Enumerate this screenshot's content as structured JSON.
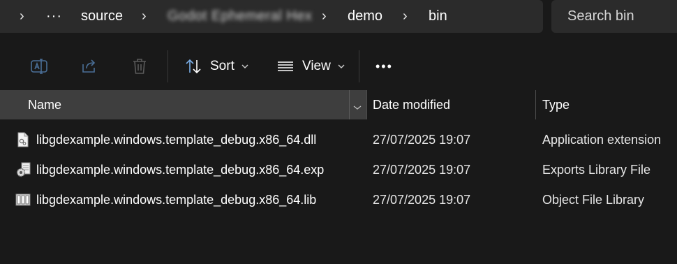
{
  "address": {
    "overflow": "···",
    "crumbs": [
      "source",
      "Godot Ephemeral Hex",
      "demo",
      "bin"
    ]
  },
  "search": {
    "placeholder": "Search bin"
  },
  "toolbar": {
    "rename_icon": "rename-icon",
    "share_icon": "share-icon",
    "delete_icon": "trash-icon",
    "sort_label": "Sort",
    "view_label": "View",
    "more_label": "•••"
  },
  "columns": {
    "name": "Name",
    "date": "Date modified",
    "type": "Type"
  },
  "files": [
    {
      "name": "libgdexample.windows.template_debug.x86_64.dll",
      "date": "27/07/2025 19:07",
      "type": "Application extension",
      "icon": "dll-file-icon"
    },
    {
      "name": "libgdexample.windows.template_debug.x86_64.exp",
      "date": "27/07/2025 19:07",
      "type": "Exports Library File",
      "icon": "gear-file-icon"
    },
    {
      "name": "libgdexample.windows.template_debug.x86_64.lib",
      "date": "27/07/2025 19:07",
      "type": "Object File Library",
      "icon": "library-file-icon"
    }
  ],
  "colors": {
    "background": "#191919",
    "bar": "#2b2b2b",
    "header_selected": "#3e3e3e",
    "accent_icon": "#4a8fd9"
  }
}
